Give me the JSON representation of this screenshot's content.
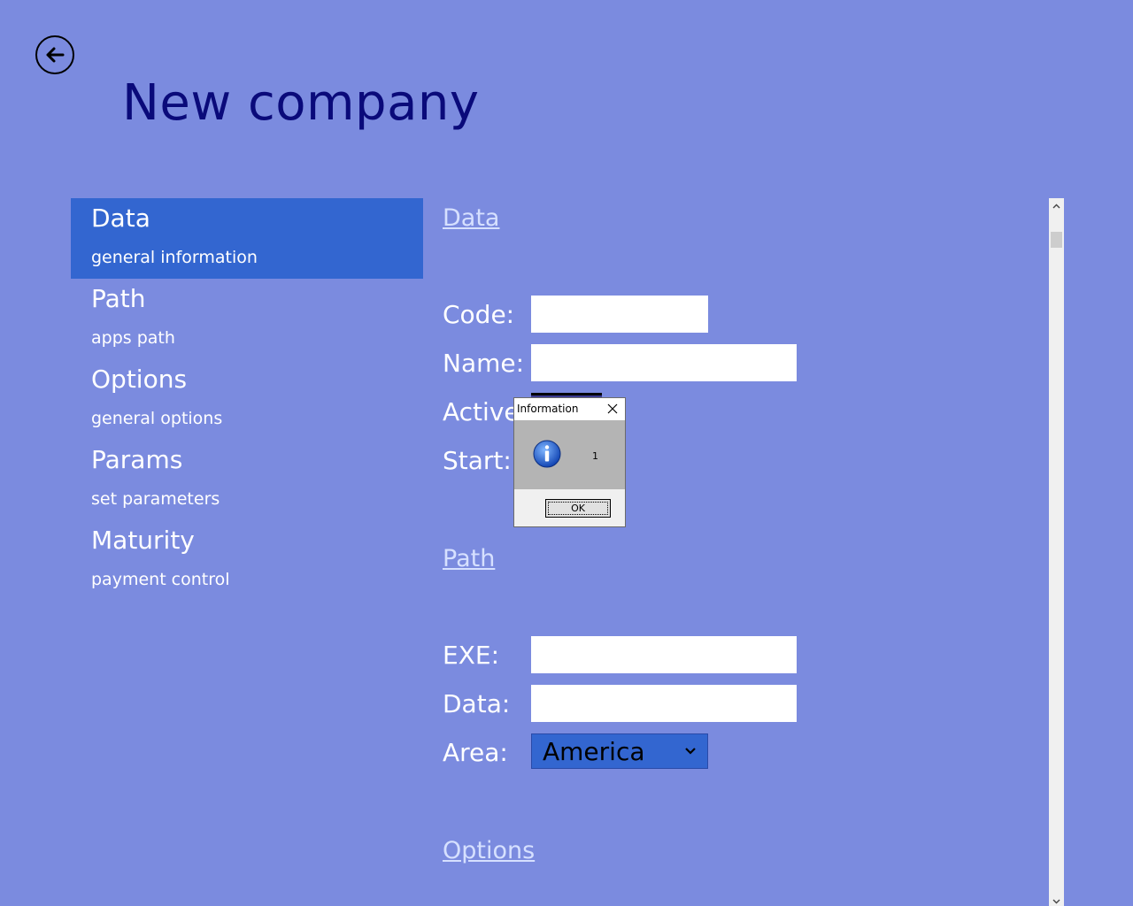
{
  "page": {
    "title": "New company"
  },
  "nav": {
    "items": [
      {
        "title": "Data",
        "subtitle": "general information",
        "selected": true
      },
      {
        "title": "Path",
        "subtitle": "apps path"
      },
      {
        "title": "Options",
        "subtitle": "general options"
      },
      {
        "title": "Params",
        "subtitle": "set parameters"
      },
      {
        "title": "Maturity",
        "subtitle": "payment control"
      }
    ]
  },
  "form": {
    "sections": {
      "data": "Data",
      "path": "Path",
      "options": "Options"
    },
    "labels": {
      "code": "Code:",
      "name": "Name:",
      "active": "Active",
      "start": "Start:",
      "exe": "EXE:",
      "data": "Data:",
      "area": "Area:"
    },
    "values": {
      "code": "",
      "name": "",
      "exe": "",
      "data": ""
    },
    "area": {
      "selected": "America"
    }
  },
  "dialog": {
    "title": "Information",
    "message": "1",
    "ok_label": "OK"
  },
  "icons": {
    "back": "back-arrow-icon",
    "close": "close-icon",
    "info": "info-icon",
    "chevron": "chevron-down-icon"
  },
  "colors": {
    "background": "#7b8bdf",
    "accent": "#3366d0",
    "title": "#0a0a7a"
  }
}
